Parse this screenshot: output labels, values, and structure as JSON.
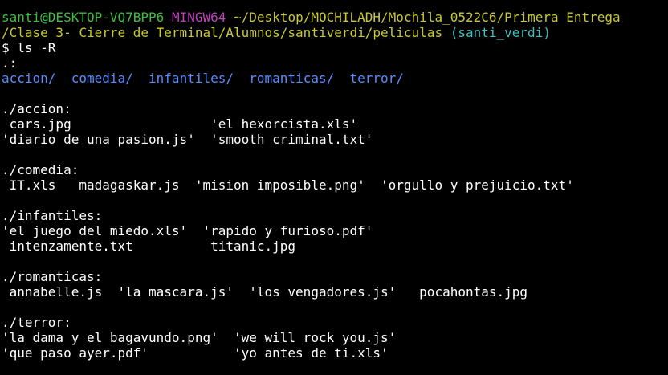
{
  "prompt": {
    "user_host": "santi@DESKTOP-VQ7BPP6",
    "system": "MINGW64",
    "path_line1": "~/Desktop/MOCHILADH/Mochila_0522C6/Primera Entrega",
    "path_line2": "/Clase 3- Cierre de Terminal/Alumnos/santiverdi/peliculas",
    "branch": "(santi_verdi)"
  },
  "command": "$ ls -R",
  "root_header": ".:",
  "root_dirs": [
    "accion/",
    "comedia/",
    "infantiles/",
    "romanticas/",
    "terror/"
  ],
  "colors": {
    "background": "#000000",
    "text": "#ffffff",
    "user_host": "#3fbf3f",
    "system": "#c040c0",
    "path": "#c8c832",
    "branch": "#3fbfbf",
    "directory": "#5a8cff"
  },
  "sections": {
    "accion": {
      "header": "./accion:",
      "lines": [
        " cars.jpg                  'el hexorcista.xls'",
        "'diario de una pasion.js'  'smooth criminal.txt'"
      ]
    },
    "comedia": {
      "header": "./comedia:",
      "lines": [
        " IT.xls   madagaskar.js  'mision imposible.png'  'orgullo y prejuicio.txt'"
      ]
    },
    "infantiles": {
      "header": "./infantiles:",
      "lines": [
        "'el juego del miedo.xls'  'rapido y furioso.pdf'",
        " intenzamente.txt          titanic.jpg"
      ]
    },
    "romanticas": {
      "header": "./romanticas:",
      "lines": [
        " annabelle.js  'la mascara.js'  'los vengadores.js'   pocahontas.jpg"
      ]
    },
    "terror": {
      "header": "./terror:",
      "lines": [
        "'la dama y el bagavundo.png'  'we will rock you.js'",
        "'que paso ayer.pdf'           'yo antes de ti.xls'"
      ]
    }
  }
}
